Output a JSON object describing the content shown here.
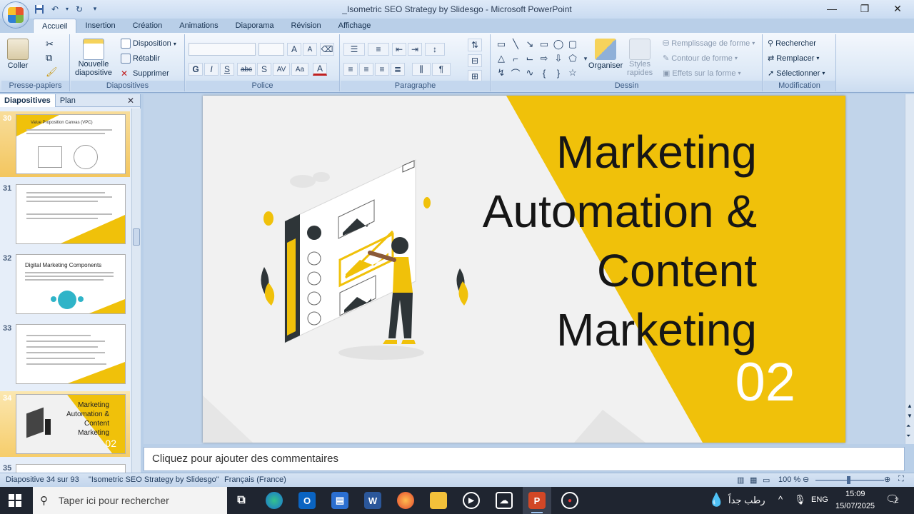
{
  "window": {
    "title": "_Isometric SEO Strategy by Slidesgo - Microsoft PowerPoint",
    "controls": [
      "—",
      "❐",
      "✕"
    ]
  },
  "tabs": [
    "Accueil",
    "Insertion",
    "Création",
    "Animations",
    "Diaporama",
    "Révision",
    "Affichage"
  ],
  "ribbon": {
    "presse_papiers": {
      "label": "Presse-papiers",
      "coller": "Coller"
    },
    "diapositives": {
      "label": "Diapositives",
      "nouvelle": "Nouvelle",
      "nouvelle2": "diapositive",
      "disposition": "Disposition",
      "retablir": "Rétablir",
      "supprimer": "Supprimer"
    },
    "police": {
      "label": "Police",
      "buttons": [
        "G",
        "I",
        "S",
        "abc",
        "S",
        "AV",
        "Aa",
        "A"
      ]
    },
    "paragraphe": {
      "label": "Paragraphe"
    },
    "dessin": {
      "label": "Dessin",
      "organiser": "Organiser",
      "styles": "Styles",
      "rapides": "rapides",
      "remplissage": "Remplissage de forme",
      "contour": "Contour de forme",
      "effets": "Effets sur la forme"
    },
    "modification": {
      "label": "Modification",
      "rechercher": "Rechercher",
      "remplacer": "Remplacer",
      "selectionner": "Sélectionner"
    }
  },
  "left_panel": {
    "tab_diapositives": "Diapositives",
    "tab_plan": "Plan",
    "thumbnails": [
      {
        "num": "30",
        "title": "Value Proposition Canvas (VPC)"
      },
      {
        "num": "31",
        "title": ""
      },
      {
        "num": "32",
        "title": "Digital Marketing Components"
      },
      {
        "num": "33",
        "title": ""
      },
      {
        "num": "34",
        "title1": "Marketing",
        "title2": "Automation &",
        "title3": "Content",
        "title4": "Marketing",
        "num2": "02"
      },
      {
        "num": "35",
        "title": ""
      }
    ]
  },
  "slide": {
    "title_line1": "Marketing",
    "title_line2": "Automation &",
    "title_line3": "Content",
    "title_line4": "Marketing",
    "number": "02",
    "accent": "#f0c10a"
  },
  "notes_placeholder": "Cliquez pour ajouter des commentaires",
  "status": {
    "slide_info": "Diapositive 34 sur 93",
    "theme": "\"Isometric SEO Strategy by Slidesgo\"",
    "language": "Français (France)",
    "zoom": "100 %"
  },
  "taskbar": {
    "search_placeholder": "Taper ici pour rechercher",
    "weather": "رطب جداً",
    "lang": "ENG",
    "time": "15:09",
    "date": "15/07/2025",
    "notif_count": "2"
  }
}
